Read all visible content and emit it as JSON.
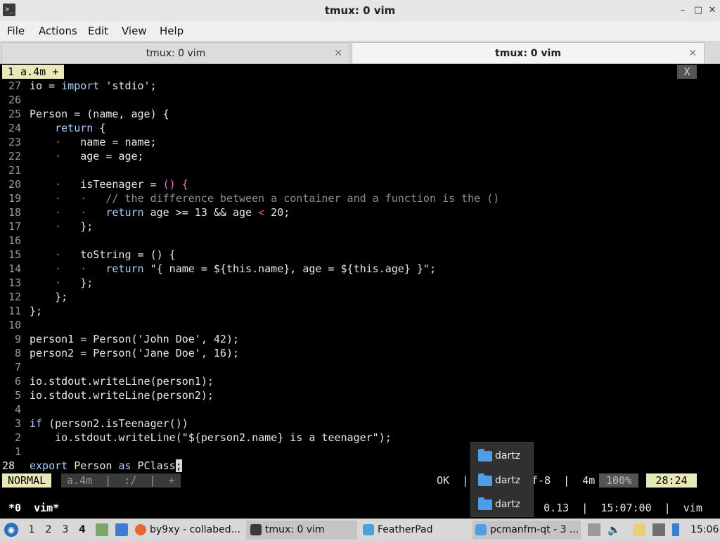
{
  "window": {
    "title": "tmux: 0 vim",
    "icon": "terminal-icon",
    "minimize": "–",
    "maximize": "□",
    "close": "✕"
  },
  "menu": [
    "File",
    "Actions",
    "Edit",
    "View",
    "Help"
  ],
  "tabs": [
    {
      "label": "tmux: 0 vim",
      "close": "✕"
    },
    {
      "label": "tmux: 0 vim",
      "close": "✕"
    }
  ],
  "vim": {
    "buffer_tab": "1  a.4m  +",
    "buffer_close": "X",
    "last_line_number": "28",
    "status": {
      "mode": "NORMAL",
      "file": "a.4m  |  :/  |  +",
      "ok": "OK  |",
      "encoding": "tf-8  |  4m",
      "percent": "100%",
      "position": "28:24"
    }
  },
  "tmux": {
    "window": "*0  vim*",
    "right": "4  0.13  |  15:07:00  |  vim"
  },
  "popup": {
    "items": [
      "dartz",
      "dartz",
      "dartz"
    ]
  },
  "taskbar": {
    "workspaces": [
      "1",
      "2",
      "3",
      "4"
    ],
    "active_workspace": "4",
    "tasks": [
      {
        "label": "by9xy - collabed..."
      },
      {
        "label": "tmux: 0 vim"
      },
      {
        "label": "FeatherPad"
      },
      {
        "label": "pcmanfm-qt - 3 ..."
      }
    ],
    "clock": "15:06"
  },
  "colors": {
    "status_yellow": "#e9e8b8",
    "keyword": "#aad0ff",
    "pink": "#ff6cd4",
    "folder": "#4f9de8"
  }
}
